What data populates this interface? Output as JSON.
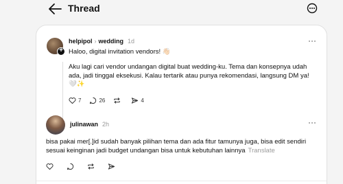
{
  "header": {
    "title": "Thread"
  },
  "post": {
    "username": "helpipol",
    "community": "wedding",
    "time": "1d",
    "greeting": "Haloo, digital invitation vendors! 👋🏻",
    "body": "Aku lagi cari vendor undangan digital buat wedding-ku. Tema dan konsepnya udah ada, jadi tinggal eksekusi. Kalau tertarik atau punya rekomendasi, langsung DM ya! 🤍✨",
    "likes": "7",
    "replies": "26",
    "shares": "4"
  },
  "reply": {
    "username": "julinawan",
    "time": "2h",
    "body": "bisa pakai mer[.]id sudah banyak pilihan tema dan ada fitur tamunya juga, bisa edit sendiri sesuai keinginan jadi budget undangan bisa untuk kebutuhan lainnya",
    "translate": "Translate"
  }
}
